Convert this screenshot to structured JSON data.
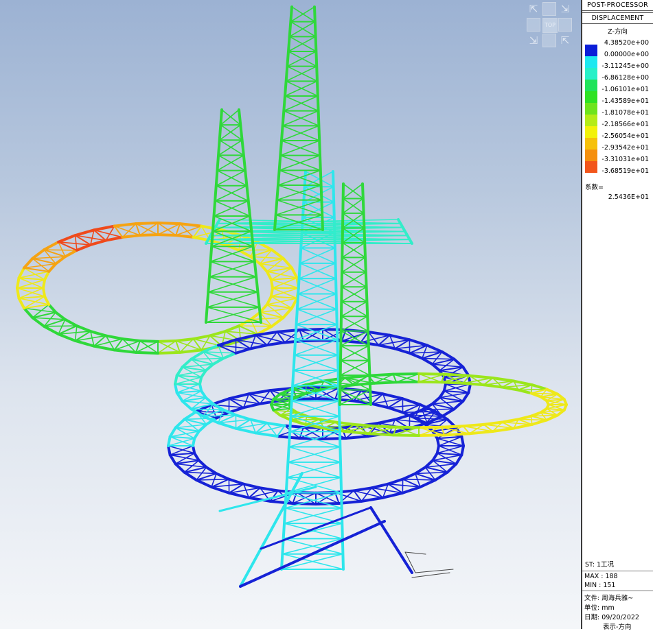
{
  "panel": {
    "title": "POST-PROCESSOR",
    "result_type": "DISPLACEMENT",
    "component": "Z-方向",
    "legend": [
      {
        "value": "4.38520e+00",
        "color": "#0b1ed8"
      },
      {
        "value": "0.00000e+00",
        "color": "#1ee8f0"
      },
      {
        "value": "-3.11245e+00",
        "color": "#27f0c8"
      },
      {
        "value": "-6.86128e+00",
        "color": "#1fe35a"
      },
      {
        "value": "-1.06101e+01",
        "color": "#2ee223"
      },
      {
        "value": "-1.43589e+01",
        "color": "#6ee41d"
      },
      {
        "value": "-1.81078e+01",
        "color": "#b4ec18"
      },
      {
        "value": "-2.18566e+01",
        "color": "#f2f20a"
      },
      {
        "value": "-2.56054e+01",
        "color": "#f6c10a"
      },
      {
        "value": "-2.93542e+01",
        "color": "#f5900e"
      },
      {
        "value": "-3.31031e+01",
        "color": "#f2561b"
      },
      {
        "value": "-3.68519e+01",
        "color": ""
      }
    ],
    "factor_label": "系数=",
    "factor_value": "2.5436E+01",
    "st_label": "ST: 1工况",
    "max_label": "MAX : 188",
    "min_label": "MIN : 151",
    "file_label": "文件: 周海兵雅~",
    "unit_label": "单位: mm",
    "date_label": "日期: 09/20/2022",
    "view_label": "表示-方向"
  },
  "nav_cube": {
    "face_label": "TOP"
  }
}
